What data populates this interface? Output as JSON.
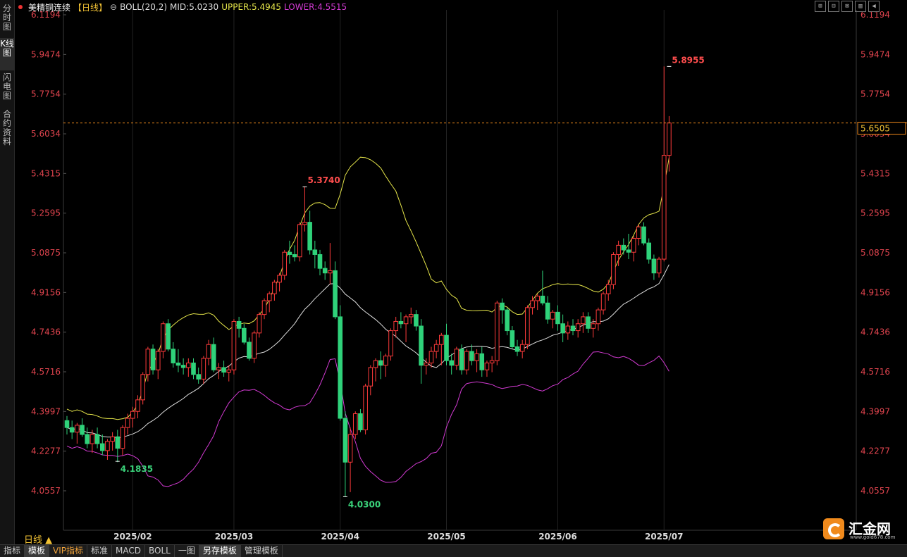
{
  "sidebar": {
    "tabs": [
      {
        "label": "分时图",
        "active": false
      },
      {
        "label": "K线图",
        "active": true
      },
      {
        "label": "闪电图",
        "active": false
      },
      {
        "label": "合约资料",
        "active": false
      }
    ]
  },
  "legend": {
    "symbol": "美精铜连续",
    "period": "【日线】",
    "indicator": "BOLL(20,2)",
    "mid": "MID:5.0230",
    "upper": "UPPER:5.4945",
    "lower": "LOWER:4.5515",
    "colors": {
      "symbol": "#ffffff",
      "period": "#f2c234",
      "mid": "#dddddd",
      "upper": "#e6e64a",
      "lower": "#d23ad2"
    }
  },
  "toolbar": {
    "buttons": [
      "⊞",
      "⊟",
      "⊠",
      "▥",
      "◀"
    ]
  },
  "period_label": "日线 ▲",
  "bottom_tabs": [
    {
      "label": "指标",
      "style": "normal"
    },
    {
      "label": "模板",
      "style": "hl"
    },
    {
      "label": "VIP指标",
      "style": "vip"
    },
    {
      "label": "标准",
      "style": "normal"
    },
    {
      "label": "MACD",
      "style": "normal"
    },
    {
      "label": "BOLL",
      "style": "normal"
    },
    {
      "label": "一图",
      "style": "normal"
    },
    {
      "label": "另存模板",
      "style": "hl"
    },
    {
      "label": "管理模板",
      "style": "normal"
    }
  ],
  "logo": {
    "text": "汇金网",
    "sub": "www.gold678.com"
  },
  "chart_data": {
    "type": "candlestick",
    "title": "美精铜连续【日线】",
    "y_ticks": [
      "6.1194",
      "5.9474",
      "5.7754",
      "5.6034",
      "5.4315",
      "5.2595",
      "5.0875",
      "4.9156",
      "4.7436",
      "4.5716",
      "4.3997",
      "4.2277",
      "4.0557"
    ],
    "y_tick_values": [
      6.1194,
      5.9474,
      5.7754,
      5.6034,
      5.4315,
      5.2595,
      5.0875,
      4.9156,
      4.7436,
      4.5716,
      4.3997,
      4.2277,
      4.0557
    ],
    "x_ticks": [
      {
        "label": "2025/02",
        "index": 13
      },
      {
        "label": "2025/03",
        "index": 33
      },
      {
        "label": "2025/04",
        "index": 54
      },
      {
        "label": "2025/05",
        "index": 75
      },
      {
        "label": "2025/06",
        "index": 97
      },
      {
        "label": "2025/07",
        "index": 118
      }
    ],
    "current_price": 5.6505,
    "current_price_label": "5.6505",
    "annotations": [
      {
        "text": "5.3740",
        "index": 47,
        "value": 5.374,
        "kind": "high",
        "color": "#ff4d4d"
      },
      {
        "text": "4.1835",
        "index": 10,
        "value": 4.1835,
        "kind": "low",
        "color": "#3ad27a"
      },
      {
        "text": "4.0300",
        "index": 55,
        "value": 4.03,
        "kind": "low",
        "color": "#3ad27a"
      },
      {
        "text": "5.8955",
        "index": 119,
        "value": 5.8955,
        "kind": "high",
        "color": "#ff4d4d"
      }
    ],
    "ohlc": [
      [
        4.36,
        4.38,
        4.3,
        4.33
      ],
      [
        4.33,
        4.36,
        4.28,
        4.31
      ],
      [
        4.31,
        4.35,
        4.26,
        4.34
      ],
      [
        4.34,
        4.37,
        4.29,
        4.3
      ],
      [
        4.3,
        4.33,
        4.24,
        4.26
      ],
      [
        4.26,
        4.32,
        4.22,
        4.3
      ],
      [
        4.3,
        4.33,
        4.24,
        4.26
      ],
      [
        4.26,
        4.3,
        4.21,
        4.23
      ],
      [
        4.23,
        4.28,
        4.19,
        4.27
      ],
      [
        4.27,
        4.31,
        4.23,
        4.29
      ],
      [
        4.29,
        4.32,
        4.18,
        4.24
      ],
      [
        4.24,
        4.34,
        4.21,
        4.33
      ],
      [
        4.33,
        4.39,
        4.3,
        4.37
      ],
      [
        4.37,
        4.42,
        4.33,
        4.4
      ],
      [
        4.4,
        4.47,
        4.37,
        4.45
      ],
      [
        4.45,
        4.57,
        4.43,
        4.56
      ],
      [
        4.56,
        4.68,
        4.53,
        4.67
      ],
      [
        4.67,
        4.69,
        4.56,
        4.58
      ],
      [
        4.58,
        4.67,
        4.54,
        4.66
      ],
      [
        4.66,
        4.79,
        4.63,
        4.78
      ],
      [
        4.78,
        4.8,
        4.66,
        4.67
      ],
      [
        4.67,
        4.7,
        4.59,
        4.61
      ],
      [
        4.61,
        4.67,
        4.57,
        4.6
      ],
      [
        4.6,
        4.63,
        4.56,
        4.59
      ],
      [
        4.59,
        4.63,
        4.55,
        4.61
      ],
      [
        4.61,
        4.63,
        4.54,
        4.56
      ],
      [
        4.56,
        4.59,
        4.52,
        4.54
      ],
      [
        4.54,
        4.64,
        4.52,
        4.63
      ],
      [
        4.63,
        4.71,
        4.6,
        4.69
      ],
      [
        4.69,
        4.72,
        4.57,
        4.58
      ],
      [
        4.58,
        4.61,
        4.54,
        4.59
      ],
      [
        4.59,
        4.62,
        4.55,
        4.57
      ],
      [
        4.57,
        4.6,
        4.53,
        4.58
      ],
      [
        4.58,
        4.8,
        4.56,
        4.79
      ],
      [
        4.79,
        4.81,
        4.72,
        4.76
      ],
      [
        4.76,
        4.78,
        4.69,
        4.7
      ],
      [
        4.7,
        4.72,
        4.62,
        4.63
      ],
      [
        4.63,
        4.75,
        4.61,
        4.74
      ],
      [
        4.74,
        4.83,
        4.72,
        4.82
      ],
      [
        4.82,
        4.89,
        4.8,
        4.88
      ],
      [
        4.88,
        4.92,
        4.83,
        4.91
      ],
      [
        4.91,
        4.97,
        4.88,
        4.96
      ],
      [
        4.96,
        5.0,
        4.92,
        4.99
      ],
      [
        4.99,
        5.1,
        4.97,
        5.09
      ],
      [
        5.09,
        5.14,
        5.04,
        5.08
      ],
      [
        5.08,
        5.12,
        5.05,
        5.07
      ],
      [
        5.07,
        5.22,
        5.05,
        5.21
      ],
      [
        5.21,
        5.374,
        5.18,
        5.22
      ],
      [
        5.22,
        5.27,
        5.08,
        5.1
      ],
      [
        5.1,
        5.14,
        5.02,
        5.08
      ],
      [
        5.08,
        5.1,
        4.99,
        5.02
      ],
      [
        5.02,
        5.05,
        4.97,
        5.0
      ],
      [
        5.0,
        5.13,
        4.95,
        5.01
      ],
      [
        5.01,
        5.05,
        4.8,
        4.81
      ],
      [
        4.81,
        4.86,
        4.36,
        4.37
      ],
      [
        4.37,
        4.4,
        4.03,
        4.18
      ],
      [
        4.18,
        4.33,
        4.05,
        4.3
      ],
      [
        4.3,
        4.4,
        4.28,
        4.39
      ],
      [
        4.39,
        4.41,
        4.31,
        4.32
      ],
      [
        4.32,
        4.52,
        4.3,
        4.51
      ],
      [
        4.51,
        4.6,
        4.47,
        4.59
      ],
      [
        4.59,
        4.63,
        4.53,
        4.62
      ],
      [
        4.62,
        4.66,
        4.54,
        4.6
      ],
      [
        4.6,
        4.65,
        4.55,
        4.64
      ],
      [
        4.64,
        4.76,
        4.62,
        4.75
      ],
      [
        4.75,
        4.81,
        4.72,
        4.79
      ],
      [
        4.79,
        4.83,
        4.76,
        4.78
      ],
      [
        4.78,
        4.82,
        4.7,
        4.81
      ],
      [
        4.81,
        4.85,
        4.78,
        4.82
      ],
      [
        4.82,
        4.84,
        4.75,
        4.77
      ],
      [
        4.77,
        4.8,
        4.52,
        4.6
      ],
      [
        4.6,
        4.63,
        4.56,
        4.61
      ],
      [
        4.61,
        4.68,
        4.59,
        4.66
      ],
      [
        4.66,
        4.71,
        4.63,
        4.69
      ],
      [
        4.69,
        4.74,
        4.6,
        4.73
      ],
      [
        4.73,
        4.78,
        4.6,
        4.62
      ],
      [
        4.62,
        4.65,
        4.56,
        4.6
      ],
      [
        4.6,
        4.68,
        4.58,
        4.67
      ],
      [
        4.67,
        4.69,
        4.56,
        4.58
      ],
      [
        4.58,
        4.67,
        4.56,
        4.66
      ],
      [
        4.66,
        4.69,
        4.6,
        4.62
      ],
      [
        4.62,
        4.67,
        4.57,
        4.65
      ],
      [
        4.65,
        4.68,
        4.55,
        4.58
      ],
      [
        4.58,
        4.62,
        4.55,
        4.61
      ],
      [
        4.61,
        4.64,
        4.57,
        4.62
      ],
      [
        4.62,
        4.88,
        4.6,
        4.87
      ],
      [
        4.87,
        4.89,
        4.78,
        4.84
      ],
      [
        4.84,
        4.85,
        4.73,
        4.75
      ],
      [
        4.75,
        4.77,
        4.67,
        4.68
      ],
      [
        4.68,
        4.71,
        4.64,
        4.66
      ],
      [
        4.66,
        4.71,
        4.63,
        4.69
      ],
      [
        4.69,
        4.86,
        4.67,
        4.85
      ],
      [
        4.85,
        4.9,
        4.82,
        4.88
      ],
      [
        4.88,
        4.91,
        4.84,
        4.9
      ],
      [
        4.9,
        5.01,
        4.86,
        4.87
      ],
      [
        4.87,
        4.9,
        4.78,
        4.8
      ],
      [
        4.8,
        4.84,
        4.76,
        4.83
      ],
      [
        4.83,
        4.86,
        4.75,
        4.78
      ],
      [
        4.78,
        4.82,
        4.7,
        4.74
      ],
      [
        4.74,
        4.79,
        4.71,
        4.77
      ],
      [
        4.77,
        4.8,
        4.73,
        4.75
      ],
      [
        4.75,
        4.8,
        4.72,
        4.78
      ],
      [
        4.78,
        4.83,
        4.74,
        4.81
      ],
      [
        4.81,
        4.83,
        4.74,
        4.76
      ],
      [
        4.76,
        4.8,
        4.72,
        4.78
      ],
      [
        4.78,
        4.85,
        4.75,
        4.84
      ],
      [
        4.84,
        4.92,
        4.82,
        4.91
      ],
      [
        4.91,
        4.97,
        4.88,
        4.95
      ],
      [
        4.95,
        5.09,
        4.93,
        5.08
      ],
      [
        5.08,
        5.14,
        5.03,
        5.12
      ],
      [
        5.12,
        5.15,
        5.08,
        5.1
      ],
      [
        5.1,
        5.17,
        5.06,
        5.09
      ],
      [
        5.09,
        5.16,
        5.05,
        5.15
      ],
      [
        5.15,
        5.21,
        5.12,
        5.2
      ],
      [
        5.2,
        5.22,
        5.12,
        5.13
      ],
      [
        5.13,
        5.15,
        5.04,
        5.06
      ],
      [
        5.06,
        5.08,
        4.97,
        5.0
      ],
      [
        5.0,
        5.07,
        4.98,
        5.06
      ],
      [
        5.06,
        5.8955,
        5.05,
        5.51
      ],
      [
        5.51,
        5.68,
        5.44,
        5.6505
      ]
    ]
  }
}
